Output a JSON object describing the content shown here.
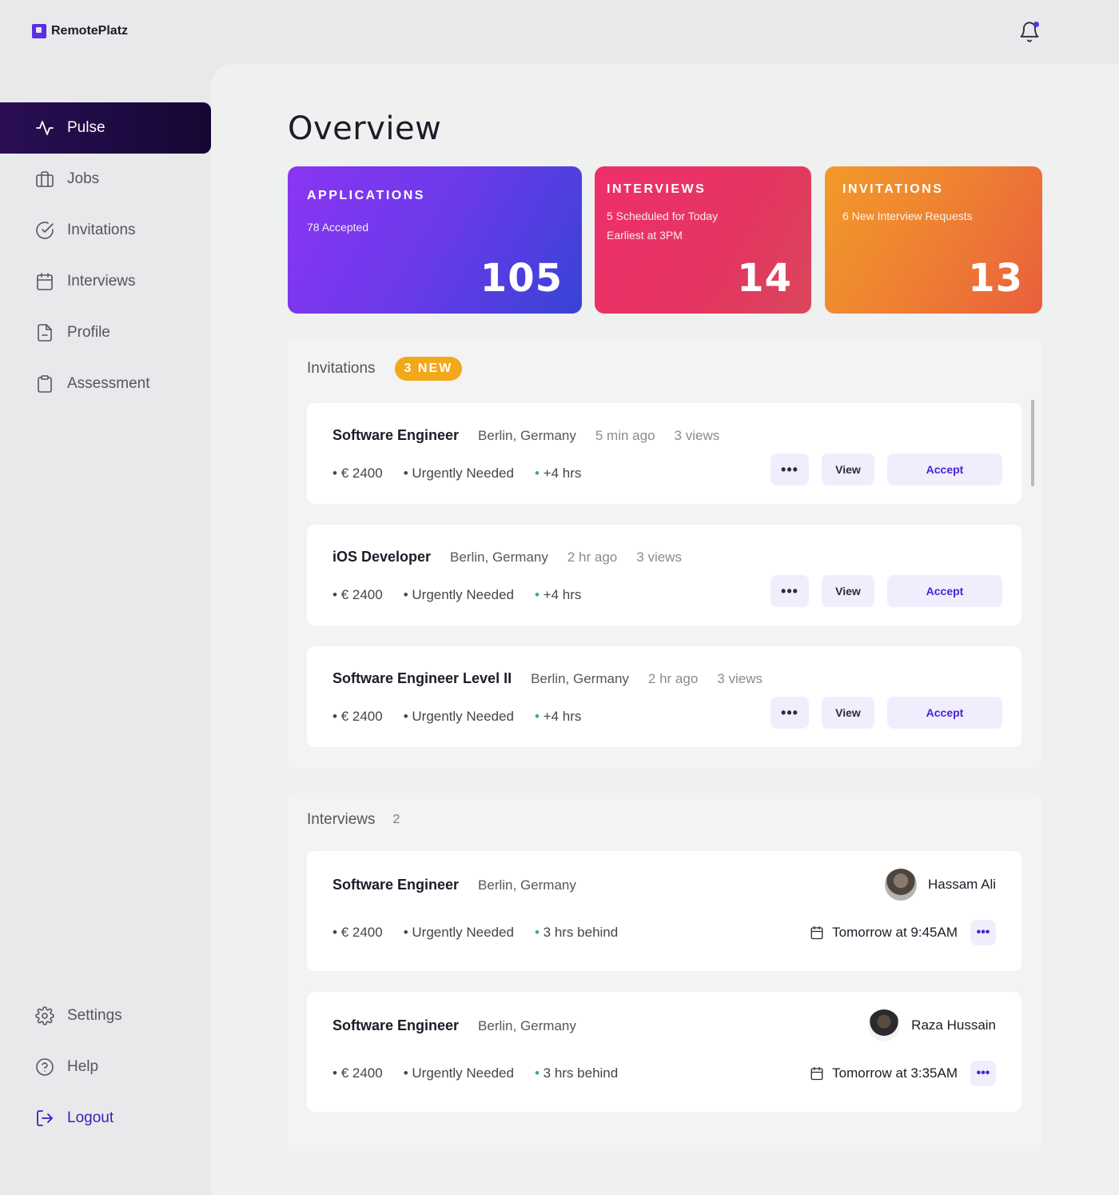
{
  "app": {
    "name": "RemotePlatz"
  },
  "sidebar": {
    "items": [
      {
        "label": "Pulse",
        "icon": "pulse-icon",
        "active": true
      },
      {
        "label": "Jobs",
        "icon": "briefcase-icon"
      },
      {
        "label": "Invitations",
        "icon": "check-circle-icon"
      },
      {
        "label": "Interviews",
        "icon": "calendar-icon"
      },
      {
        "label": "Profile",
        "icon": "document-icon"
      },
      {
        "label": "Assessment",
        "icon": "clipboard-icon"
      }
    ],
    "bottom": [
      {
        "label": "Settings",
        "icon": "gear-icon"
      },
      {
        "label": "Help",
        "icon": "help-icon"
      },
      {
        "label": "Logout",
        "icon": "logout-icon"
      }
    ]
  },
  "page": {
    "title": "Overview"
  },
  "stats": {
    "applications": {
      "label": "APPLICATIONS",
      "sub1": "78 Accepted",
      "value": "105"
    },
    "interviews": {
      "label": "INTERVIEWS",
      "sub1": "5 Scheduled for Today",
      "sub2": "Earliest at 3PM",
      "value": "14"
    },
    "invitations": {
      "label": "INVITATIONS",
      "sub1": "6 New Interview Requests",
      "value": "13"
    }
  },
  "invitations": {
    "heading": "Invitations",
    "badge": "3 NEW",
    "buttons": {
      "more": "•••",
      "view": "View",
      "accept": "Accept"
    },
    "items": [
      {
        "title": "Software Engineer",
        "location": "Berlin, Germany",
        "time": "5 min ago",
        "views": "3 views",
        "salary": "€ 2400",
        "urgency": "Urgently Needed",
        "hours": "+4 hrs"
      },
      {
        "title": "iOS Developer",
        "location": "Berlin, Germany",
        "time": "2 hr ago",
        "views": "3 views",
        "salary": "€ 2400",
        "urgency": "Urgently Needed",
        "hours": "+4 hrs"
      },
      {
        "title": "Software Engineer Level II",
        "location": "Berlin, Germany",
        "time": "2 hr ago",
        "views": "3 views",
        "salary": "€ 2400",
        "urgency": "Urgently Needed",
        "hours": "+4 hrs"
      }
    ]
  },
  "interviews": {
    "heading": "Interviews",
    "count": "2",
    "items": [
      {
        "title": "Software Engineer",
        "location": "Berlin, Germany",
        "person": "Hassam Ali",
        "salary": "€ 2400",
        "urgency": "Urgently Needed",
        "offset": "3 hrs behind",
        "schedule": "Tomorrow at 9:45AM"
      },
      {
        "title": "Software Engineer",
        "location": "Berlin, Germany",
        "person": "Raza Hussain",
        "salary": "€ 2400",
        "urgency": "Urgently Needed",
        "offset": "3 hrs behind",
        "schedule": "Tomorrow at 3:35AM"
      }
    ]
  },
  "colors": {
    "accent": "#5a2ee5",
    "nav_active": "#1c0a40",
    "badge": "#f1a81a"
  }
}
